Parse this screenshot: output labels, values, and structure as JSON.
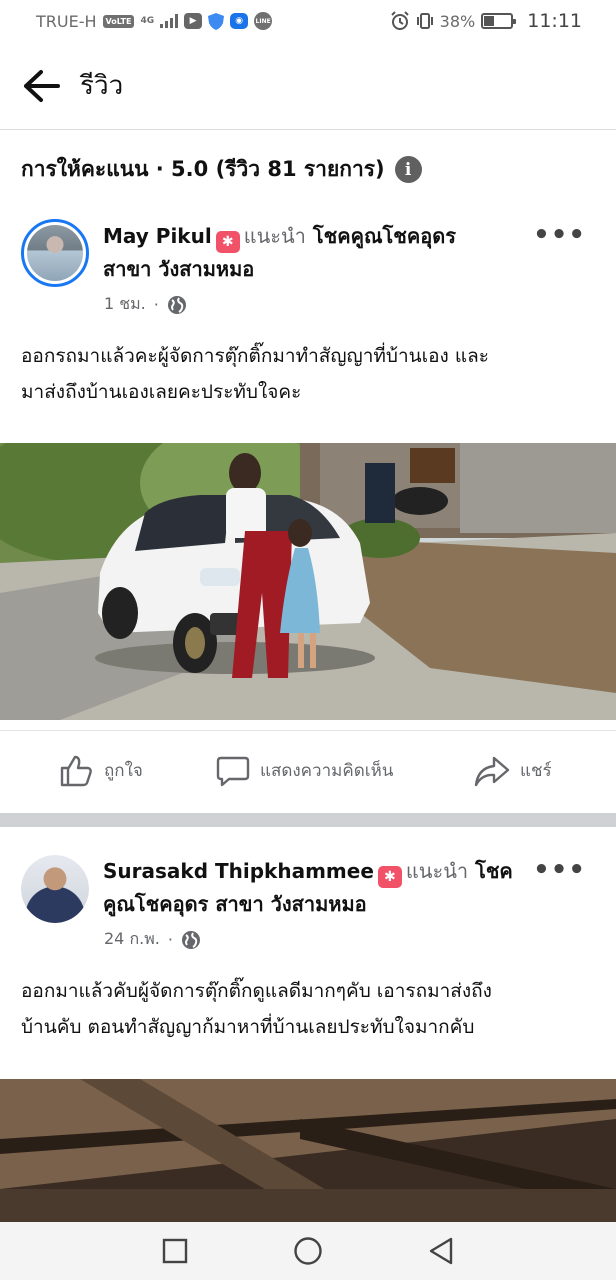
{
  "status_bar": {
    "carrier": "TRUE-H",
    "volte": "VoLTE",
    "network": "4G",
    "battery": "38%",
    "time": "11:11",
    "line_label": "LINE"
  },
  "header": {
    "title": "รีวิว",
    "back_icon": "arrow-left-icon"
  },
  "rating": {
    "label": "การให้คะแนน · 5.0 (รีวิว 81 รายการ)",
    "info_icon": "i"
  },
  "reviews": [
    {
      "name": "May Pikul",
      "recommend": "แนะนำ",
      "business_line1": "โชคคูณโชคอุดร",
      "business_line2": "สาขา วังสามหมอ",
      "time": "1 ชม.",
      "dot": "·",
      "text_line1": "ออกรถมาแล้วคะผู้จัดการตุ๊กติ๊กมาทำสัญญาที่บ้านเอง และ",
      "text_line2": "มาส่งถึงบ้านเองเลยคะประทับใจคะ"
    },
    {
      "name": "Surasakd Thipkhammee",
      "recommend": "แนะนำ",
      "business_line1": "โชค",
      "business_line2": "คูณโชคอุดร สาขา วังสามหมอ",
      "time": "24 ก.พ.",
      "dot": "·",
      "text_line1": "ออกมาแล้วคับผู้จัดการตุ๊กติ๊กดูแลดีมากๆคับ เอารถมาส่งถึง",
      "text_line2": "บ้านคับ ตอนทำสัญญาก้มาหาที่บ้านเลยประทับใจมากคับ"
    }
  ],
  "actions": {
    "like": "ถูกใจ",
    "comment": "แสดงความคิดเห็น",
    "share": "แชร์"
  },
  "more_label": "•••",
  "colors": {
    "accent": "#1877f2",
    "badge": "#f25268",
    "muted": "#65676b"
  }
}
